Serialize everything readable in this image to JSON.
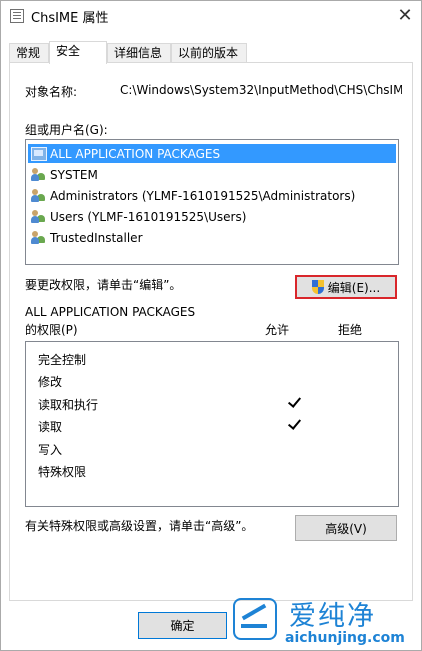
{
  "window": {
    "title": "ChsIME 属性",
    "close_glyph": "✕"
  },
  "tabs": [
    {
      "label": "常规",
      "active": false
    },
    {
      "label": "安全",
      "active": true
    },
    {
      "label": "详细信息",
      "active": false
    },
    {
      "label": "以前的版本",
      "active": false
    }
  ],
  "security": {
    "object_name_label": "对象名称:",
    "object_name_value": "C:\\Windows\\System32\\InputMethod\\CHS\\ChsIM",
    "groups_label": "组或用户名(G):",
    "groups": [
      {
        "name": "ALL APPLICATION PACKAGES",
        "icon": "package-icon",
        "selected": true
      },
      {
        "name": "SYSTEM",
        "icon": "users-icon",
        "selected": false
      },
      {
        "name": "Administrators (YLMF-1610191525\\Administrators)",
        "icon": "users-icon",
        "selected": false
      },
      {
        "name": "Users (YLMF-1610191525\\Users)",
        "icon": "users-icon",
        "selected": false
      },
      {
        "name": "TrustedInstaller",
        "icon": "users-icon",
        "selected": false
      }
    ],
    "edit_hint": "要更改权限，请单击“编辑”。",
    "edit_button": "编辑(E)...",
    "permissions_for": "ALL APPLICATION PACKAGES",
    "permissions_label": "的权限(P)",
    "allow_header": "允许",
    "deny_header": "拒绝",
    "permissions": [
      {
        "name": "完全控制",
        "allow": false,
        "deny": false
      },
      {
        "name": "修改",
        "allow": false,
        "deny": false
      },
      {
        "name": "读取和执行",
        "allow": true,
        "deny": false
      },
      {
        "name": "读取",
        "allow": true,
        "deny": false
      },
      {
        "name": "写入",
        "allow": false,
        "deny": false
      },
      {
        "name": "特殊权限",
        "allow": false,
        "deny": false
      }
    ],
    "advanced_hint": "有关特殊权限或高级设置，请单击“高级”。",
    "advanced_button": "高级(V)"
  },
  "footer": {
    "ok_button": "确定"
  },
  "watermark": {
    "brand": "爱纯净",
    "url": "aichunjing.com"
  },
  "colors": {
    "selection": "#3399ff",
    "highlight_border": "#d9262b",
    "watermark": "#1e83d5"
  }
}
